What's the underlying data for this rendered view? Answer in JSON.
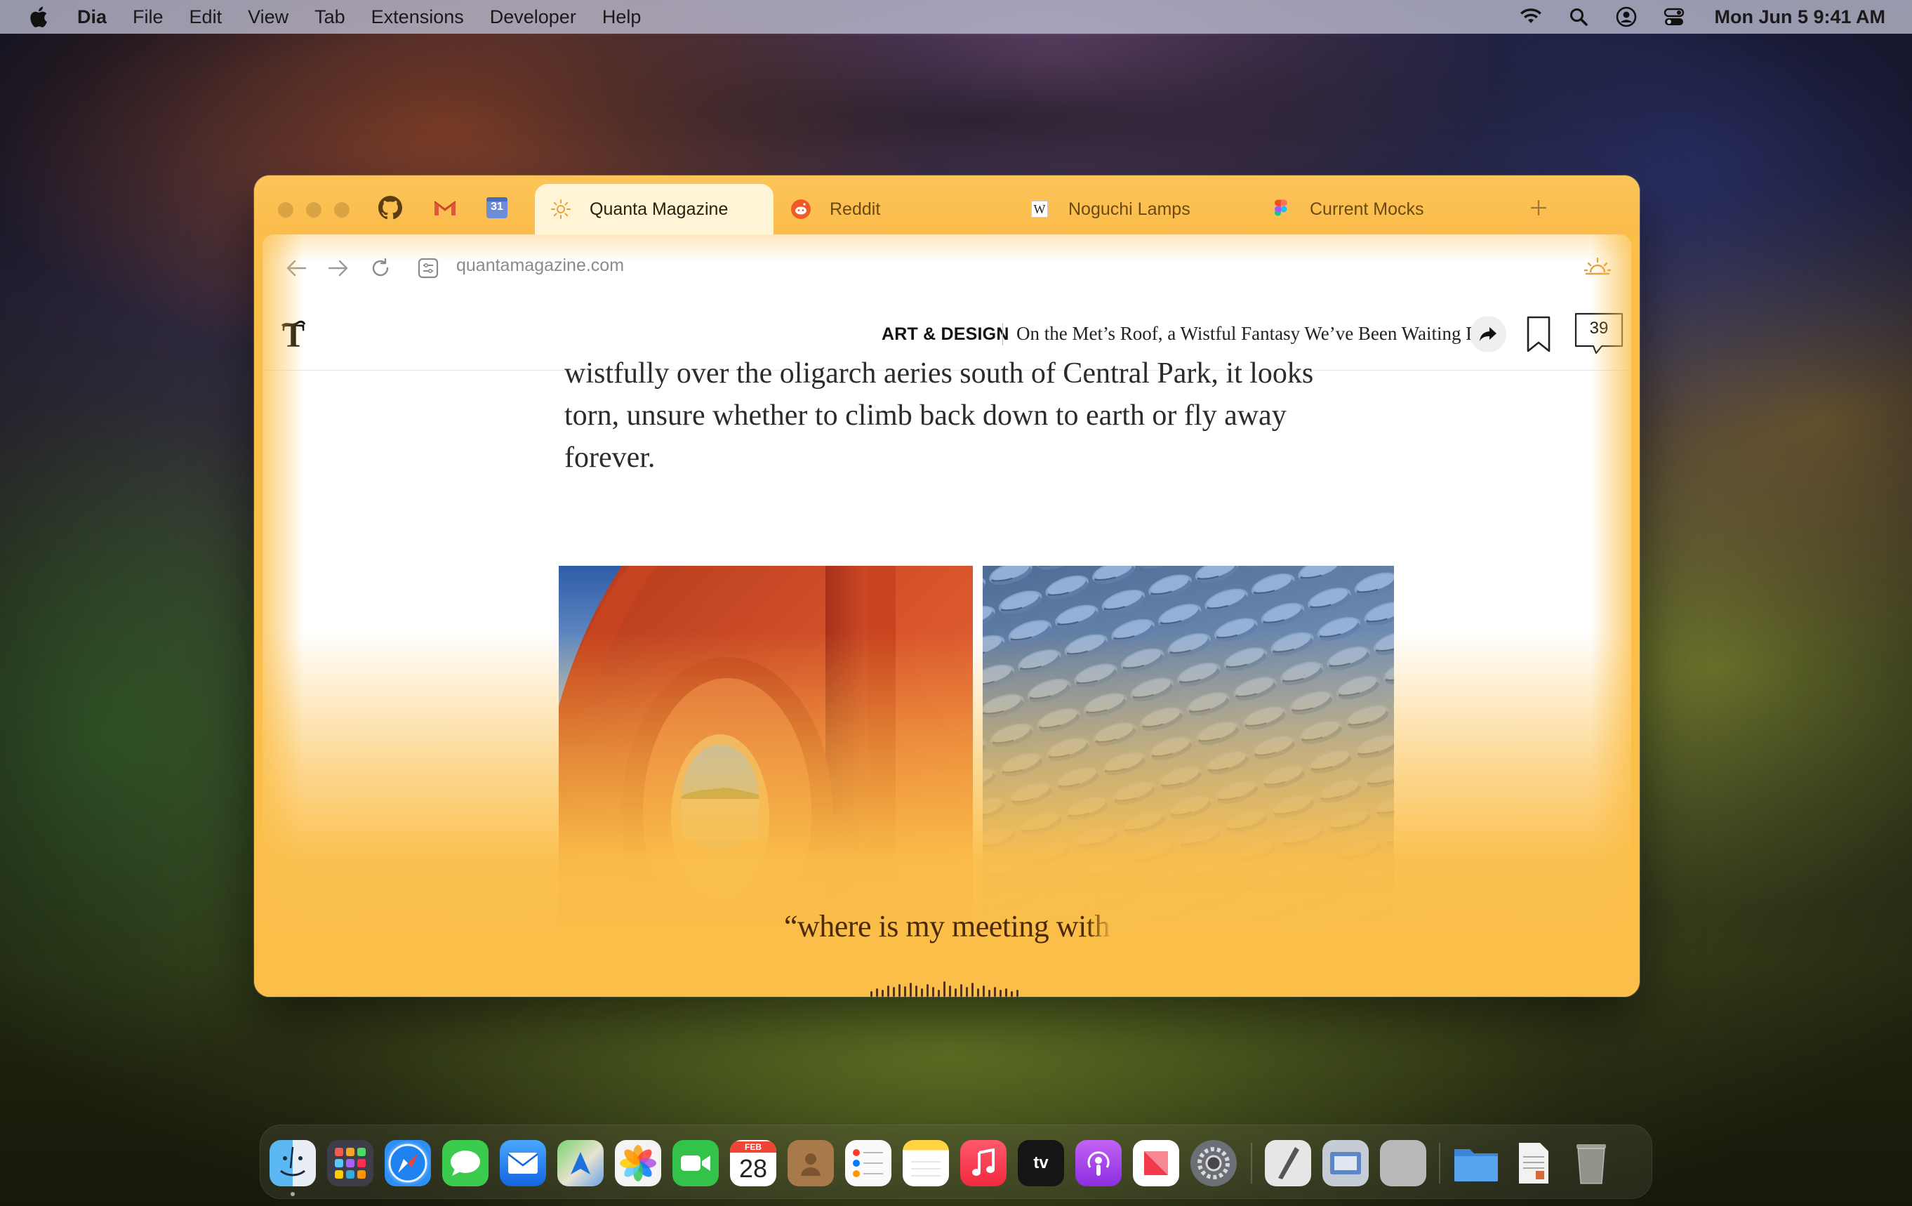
{
  "menubar": {
    "app_name": "Dia",
    "menus": [
      "File",
      "Edit",
      "View",
      "Tab",
      "Extensions",
      "Developer",
      "Help"
    ],
    "clock": "Mon Jun 5  9:41 AM",
    "status_icons": [
      "wifi-icon",
      "spotlight-search-icon",
      "user-account-icon",
      "control-center-icon"
    ]
  },
  "browser": {
    "pinned_tabs": [
      "github-icon",
      "gmail-icon",
      "google-calendar-icon"
    ],
    "calendar_badge": "31",
    "tabs": [
      {
        "title": "Quanta Magazine",
        "icon": "sun-favicon-icon",
        "active": true
      },
      {
        "title": "Reddit",
        "icon": "reddit-icon",
        "active": false
      },
      {
        "title": "Noguchi Lamps",
        "icon": "wikipedia-icon",
        "active": false
      },
      {
        "title": "Current Mocks",
        "icon": "figma-icon",
        "active": false
      }
    ],
    "wiki_glyph": "W",
    "url": "quantamagazine.com"
  },
  "article": {
    "section": "ART & DESIGN",
    "headline": "On the Met’s Roof, a Wistful Fantasy We’ve Been Waiting For",
    "comment_count": "39",
    "body_lines": [
      "wistfully over the oligarch aeries south of Central Park, it looks",
      "torn, unsure whether to climb back down to earth or fly away",
      "forever."
    ]
  },
  "assistant": {
    "transcript_main": "“where is my meeting wi",
    "transcript_fading": "th"
  },
  "dock": {
    "calendar_month": "FEB",
    "calendar_day": "28",
    "tv_label": "tv",
    "apps": [
      "finder",
      "launchpad",
      "safari",
      "messages",
      "mail",
      "maps",
      "photos",
      "facetime",
      "calendar",
      "contacts",
      "reminders",
      "notes",
      "music",
      "apple-tv",
      "podcasts",
      "news",
      "system-settings",
      "script-editor",
      "preview",
      "blank-app",
      "folder",
      "document",
      "trash"
    ]
  },
  "colors": {
    "accent_yellow": "#fbbe49",
    "active_tab": "#fff4d6",
    "transcript_text": "#4a2a08"
  }
}
